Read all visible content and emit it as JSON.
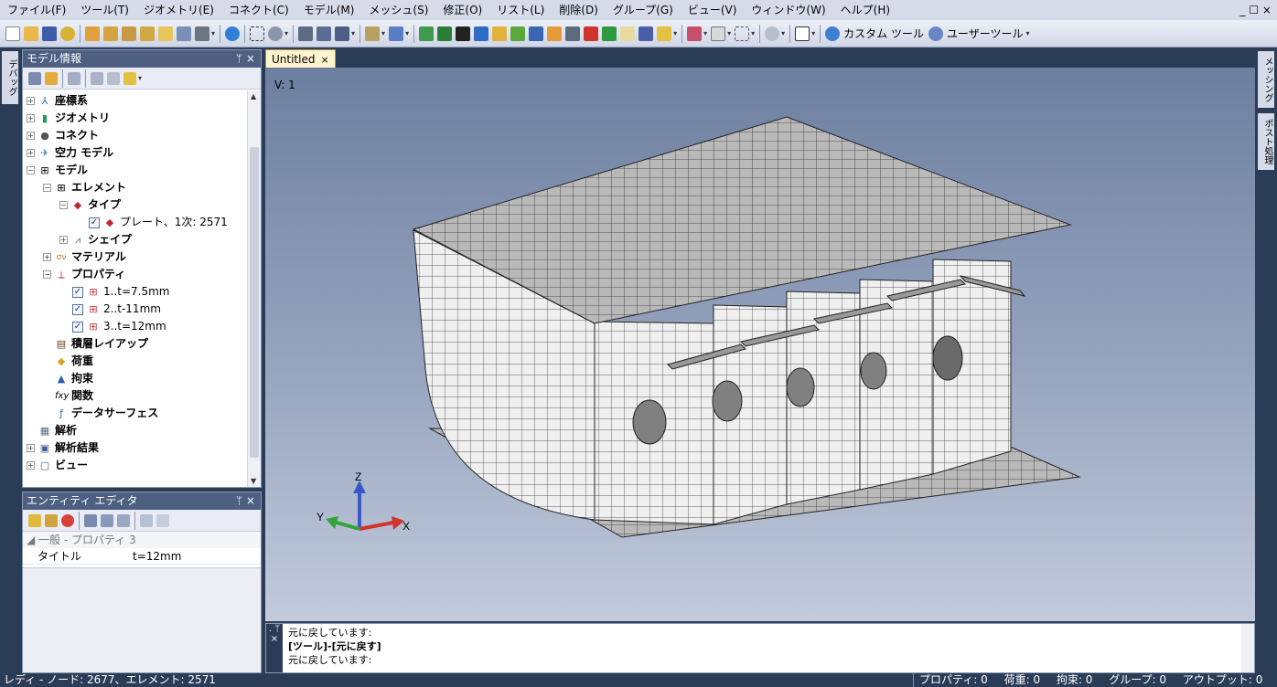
{
  "menubar": {
    "items": [
      "ファイル(F)",
      "ツール(T)",
      "ジオメトリ(E)",
      "コネクト(C)",
      "モデル(M)",
      "メッシュ(S)",
      "修正(O)",
      "リスト(L)",
      "削除(D)",
      "グループ(G)",
      "ビュー(V)",
      "ウィンドウ(W)",
      "ヘルプ(H)"
    ],
    "window_controls": "_ ☐ ×"
  },
  "toolbar": {
    "custom_tools_label": "カスタム ツール",
    "user_tools_label": "ユーザーツール"
  },
  "left_strip": {
    "tab_label": "デバッグ"
  },
  "right_strip": {
    "tab_meshing": "メッシング",
    "tab_post": "ポスト処理"
  },
  "model_panel": {
    "title": "モデル情報",
    "pin": "ᛘ ×",
    "tree": [
      {
        "label": "座標系",
        "bold": true
      },
      {
        "label": "ジオメトリ",
        "bold": true
      },
      {
        "label": "コネクト",
        "bold": true
      },
      {
        "label": "空力 モデル",
        "bold": true
      },
      {
        "label": "モデル",
        "bold": true
      },
      {
        "label": "エレメント",
        "bold": true
      },
      {
        "label": "タイプ",
        "bold": true
      },
      {
        "label": "プレート、1次: 2571",
        "bold": false
      },
      {
        "label": "シェイプ",
        "bold": true
      },
      {
        "label": "マテリアル",
        "bold": true
      },
      {
        "label": "プロパティ",
        "bold": true
      },
      {
        "label": "1..t=7.5mm",
        "bold": false
      },
      {
        "label": "2..t-11mm",
        "bold": false
      },
      {
        "label": "3..t=12mm",
        "bold": false
      },
      {
        "label": "積層レイアップ",
        "bold": true
      },
      {
        "label": "荷重",
        "bold": true
      },
      {
        "label": "拘束",
        "bold": true
      },
      {
        "label": "関数",
        "bold": true
      },
      {
        "label": "データサーフェス",
        "bold": true
      },
      {
        "label": "解析",
        "bold": true
      },
      {
        "label": "解析結果",
        "bold": true
      },
      {
        "label": "ビュー",
        "bold": true
      }
    ]
  },
  "entity_panel": {
    "title": "エンティティ エディタ",
    "pin": "ᛘ ×",
    "section": "一般 - プロパティ 3",
    "rows": [
      {
        "key": "タイトル",
        "value": "t=12mm"
      }
    ]
  },
  "viewport": {
    "tab_label": "Untitled",
    "tab_close": "×",
    "view_label": "V: 1",
    "axes": {
      "x": "X",
      "y": "Y",
      "z": "Z"
    }
  },
  "output": {
    "lines": [
      "元に戻しています:",
      "[ツール]-[元に戻す]",
      "元に戻しています:"
    ],
    "gutter": ". ᛘ ×"
  },
  "statusbar": {
    "left": "レディ - ノード: 2677、エレメント: 2571",
    "property": "プロパティ: 0",
    "load": "荷重: 0",
    "constraint": "拘束: 0",
    "group": "グループ: 0",
    "output": "アウトプット: 0"
  }
}
